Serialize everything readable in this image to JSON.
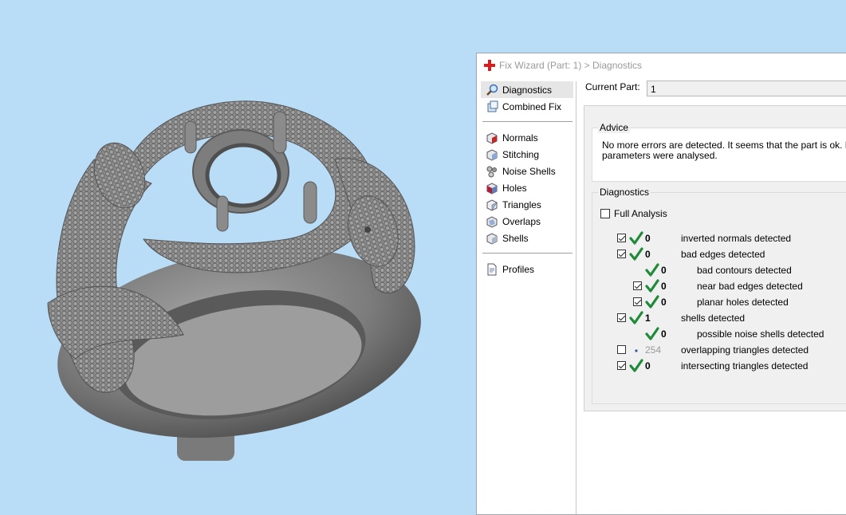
{
  "window": {
    "title": "Fix Wizard (Part: 1) > Diagnostics"
  },
  "nav": {
    "top_items": [
      {
        "label": "Diagnostics",
        "icon": "magnifier-icon",
        "selected": true
      },
      {
        "label": "Combined Fix",
        "icon": "combined-fix-icon",
        "selected": false
      }
    ],
    "fix_items": [
      {
        "label": "Normals",
        "icon": "normals-cube-icon"
      },
      {
        "label": "Stitching",
        "icon": "stitching-cube-icon"
      },
      {
        "label": "Noise Shells",
        "icon": "noise-shells-icon"
      },
      {
        "label": "Holes",
        "icon": "holes-cube-icon"
      },
      {
        "label": "Triangles",
        "icon": "triangles-cube-icon"
      },
      {
        "label": "Overlaps",
        "icon": "overlaps-cube-icon"
      },
      {
        "label": "Shells",
        "icon": "shells-cube-icon"
      }
    ],
    "bottom_items": [
      {
        "label": "Profiles",
        "icon": "profiles-document-icon"
      }
    ]
  },
  "current_part": {
    "label": "Current Part:",
    "value": "1"
  },
  "advice": {
    "title": "Advice",
    "text": "No more errors are detected. It seems that the part is ok. No\nparameters were analysed."
  },
  "diagnostics": {
    "title": "Diagnostics",
    "full_analysis_label": "Full Analysis",
    "full_analysis_checked": false,
    "rows": [
      {
        "checkbox": true,
        "checked": true,
        "status": "ok",
        "count": "0",
        "label": "inverted normals detected",
        "indent": 0
      },
      {
        "checkbox": true,
        "checked": true,
        "status": "ok",
        "count": "0",
        "label": "bad edges detected",
        "indent": 0
      },
      {
        "checkbox": false,
        "checked": false,
        "status": "ok",
        "count": "0",
        "label": "bad contours detected",
        "indent": 1
      },
      {
        "checkbox": true,
        "checked": true,
        "status": "ok",
        "count": "0",
        "label": "near bad edges detected",
        "indent": 1
      },
      {
        "checkbox": true,
        "checked": true,
        "status": "ok",
        "count": "0",
        "label": "planar holes detected",
        "indent": 1
      },
      {
        "checkbox": true,
        "checked": true,
        "status": "ok",
        "count": "1",
        "label": "shells detected",
        "indent": 0
      },
      {
        "checkbox": false,
        "checked": false,
        "status": "ok",
        "count": "0",
        "label": "possible noise shells detected",
        "indent": 1
      },
      {
        "checkbox": true,
        "checked": false,
        "status": "unknown",
        "count": "254",
        "label": "overlapping triangles detected",
        "indent": 0
      },
      {
        "checkbox": true,
        "checked": true,
        "status": "ok",
        "count": "0",
        "label": "intersecting triangles detected",
        "indent": 0
      }
    ]
  },
  "colors": {
    "viewport_background": "#b9dcf7",
    "model_gray": "#8a8a8a",
    "ok_check": "#1e8a3a",
    "title_icon_red": "#d21f1f"
  }
}
